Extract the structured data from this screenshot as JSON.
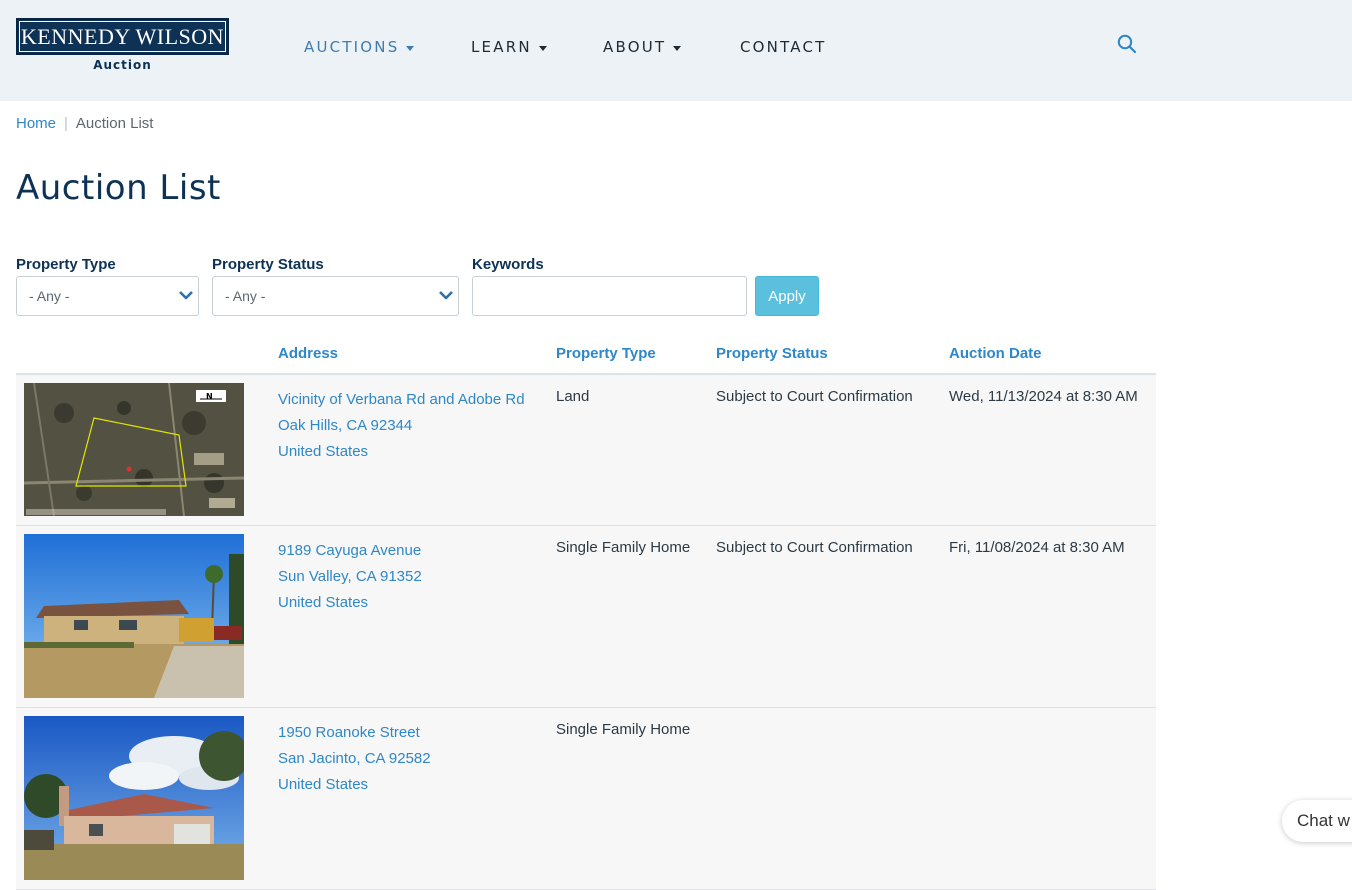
{
  "brand": {
    "logo_text": "KENNEDY WILSON",
    "logo_sub": "Auction",
    "colors": {
      "navy": "#0d3256",
      "link": "#2f87c6",
      "apply": "#5bc0de",
      "header_bg": "#edf2f6"
    }
  },
  "nav": {
    "items": [
      {
        "label": "AUCTIONS",
        "dropdown": true,
        "active": true
      },
      {
        "label": "LEARN",
        "dropdown": true,
        "active": false
      },
      {
        "label": "ABOUT",
        "dropdown": true,
        "active": false
      },
      {
        "label": "CONTACT",
        "dropdown": false,
        "active": false
      }
    ],
    "search_icon": "search-icon"
  },
  "breadcrumb": {
    "home": "Home",
    "separator": "|",
    "current": "Auction List"
  },
  "page_title": "Auction List",
  "filters": {
    "property_type": {
      "label": "Property Type",
      "value": "- Any -"
    },
    "property_status": {
      "label": "Property Status",
      "value": "- Any -"
    },
    "keywords": {
      "label": "Keywords",
      "value": "",
      "placeholder": ""
    },
    "apply_label": "Apply"
  },
  "table": {
    "headers": [
      "Address",
      "Property Type",
      "Property Status",
      "Auction Date"
    ],
    "rows": [
      {
        "image": "aerial-land-photo",
        "address": [
          "Vicinity of Verbana Rd and Adobe Rd",
          "Oak Hills, CA 92344",
          "United States"
        ],
        "property_type": "Land",
        "property_status": "Subject to Court Confirmation",
        "auction_date": "Wed, 11/13/2024 at 8:30 AM"
      },
      {
        "image": "house-photo",
        "address": [
          "9189 Cayuga Avenue",
          "Sun Valley, CA 91352",
          "United States"
        ],
        "property_type": "Single Family Home",
        "property_status": "Subject to Court Confirmation",
        "auction_date": "Fri, 11/08/2024 at 8:30 AM"
      },
      {
        "image": "house-photo",
        "address": [
          "1950 Roanoke Street",
          "San Jacinto, CA 92582",
          "United States"
        ],
        "property_type": "Single Family Home",
        "property_status": "",
        "auction_date": ""
      }
    ]
  },
  "chat": {
    "label": "Chat w"
  }
}
